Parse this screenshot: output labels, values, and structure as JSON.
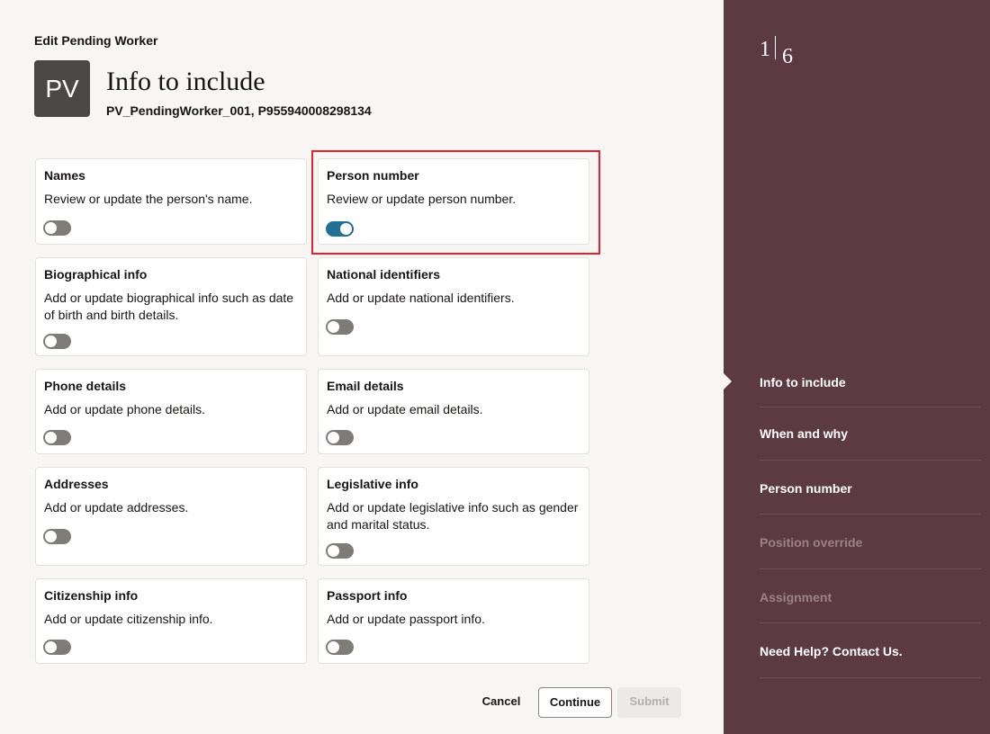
{
  "header": {
    "page_label": "Edit Pending Worker",
    "avatar_initials": "PV",
    "title": "Info to include",
    "subtitle": "PV_PendingWorker_001, P955940008298134"
  },
  "cards": [
    {
      "title": "Names",
      "description": "Review or update the person's name.",
      "enabled": false
    },
    {
      "title": "Person number",
      "description": "Review or update person number.",
      "enabled": true
    },
    {
      "title": "Biographical info",
      "description": "Add or update biographical info such as date of birth and birth details.",
      "enabled": false
    },
    {
      "title": "National identifiers",
      "description": "Add or update national identifiers.",
      "enabled": false
    },
    {
      "title": "Phone details",
      "description": "Add or update phone details.",
      "enabled": false
    },
    {
      "title": "Email details",
      "description": "Add or update email details.",
      "enabled": false
    },
    {
      "title": "Addresses",
      "description": "Add or update addresses.",
      "enabled": false
    },
    {
      "title": "Legislative info",
      "description": "Add or update legislative info such as gender and marital status.",
      "enabled": false
    },
    {
      "title": "Citizenship info",
      "description": "Add or update citizenship info.",
      "enabled": false
    },
    {
      "title": "Passport info",
      "description": "Add or update passport info.",
      "enabled": false
    }
  ],
  "footer": {
    "cancel_label": "Cancel",
    "continue_label": "Continue",
    "submit_label": "Submit"
  },
  "sidebar": {
    "current_step": "1",
    "total_steps": "6",
    "items": [
      {
        "label": "Info to include",
        "state": "active"
      },
      {
        "label": "When and why",
        "state": "enabled"
      },
      {
        "label": "Person number",
        "state": "enabled"
      },
      {
        "label": "Position override",
        "state": "disabled"
      },
      {
        "label": "Assignment",
        "state": "disabled"
      },
      {
        "label": "Need Help? Contact Us.",
        "state": "enabled"
      }
    ]
  },
  "colors": {
    "sidebar_bg": "#5c3a41",
    "toggle_on": "#227093",
    "toggle_off": "#7f7b77",
    "highlight": "#e2232a"
  }
}
